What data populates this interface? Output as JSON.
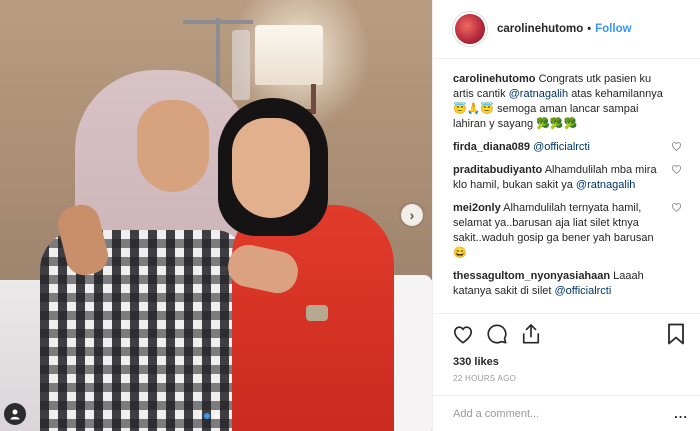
{
  "header": {
    "username": "carolinehutomo",
    "separator": "•",
    "follow_label": "Follow"
  },
  "caption": {
    "user": "carolinehutomo",
    "text_1": "Congrats utk pasien ku artis cantik",
    "mention": "@ratnagalih",
    "text_2": "atas kehamilannya 😇🙏😇 semoga aman lancar sampai lahiran y sayang 🥦🥦🥦"
  },
  "comments": [
    {
      "user": "firda_diana089",
      "pre": "",
      "mention": "@officialrcti",
      "post": ""
    },
    {
      "user": "praditabudiyanto",
      "pre": "Alhamdulilah mba mira klo hamil, bukan sakit ya",
      "mention": "@ratnagalih",
      "post": ""
    },
    {
      "user": "mei2only",
      "pre": "Alhamdulilah ternyata hamil, selamat ya..barusan aja liat silet ktnya sakit..waduh gosip ga bener yah barusan 😄",
      "mention": "",
      "post": ""
    },
    {
      "user": "thessagultom_nyonyasiahaan",
      "pre": "Laaah katanya sakit di silet",
      "mention": "@officialrcti",
      "post": ""
    }
  ],
  "likes": "330 likes",
  "time": "22 HOURS AGO",
  "add_comment": {
    "placeholder": "Add a comment...",
    "more": "..."
  },
  "photo": {
    "next_arrow": "›"
  },
  "colors": {
    "accent": "#3897f0",
    "mention": "#003569",
    "text": "#262626",
    "muted": "#999999"
  },
  "icons": [
    "heart-icon",
    "comment-icon",
    "share-icon",
    "bookmark-icon",
    "user-tag-icon",
    "chevron-right-icon"
  ]
}
